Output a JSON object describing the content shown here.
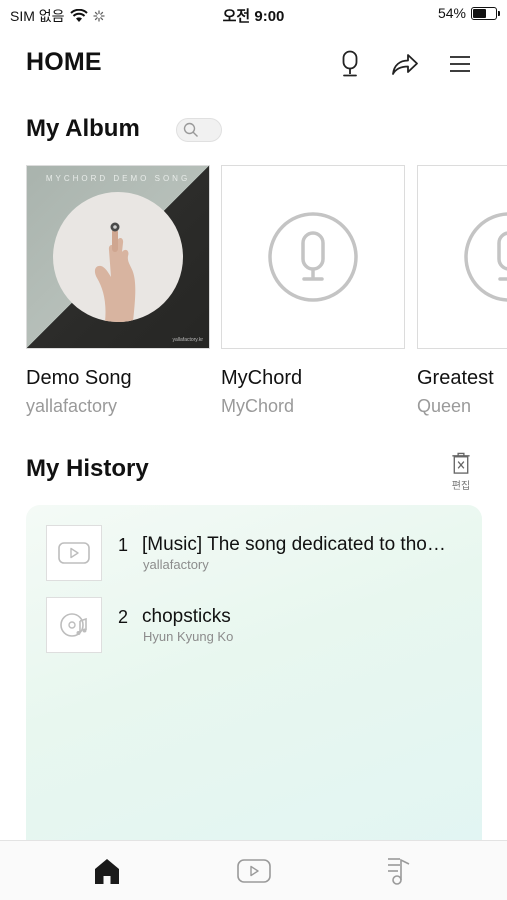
{
  "status_bar": {
    "carrier": "SIM 없음",
    "time": "오전 9:00",
    "battery": "54%",
    "battery_level": 0.54
  },
  "header": {
    "title": "HOME",
    "icons": [
      "microphone-icon",
      "share-icon",
      "menu-icon"
    ]
  },
  "album_section": {
    "title": "My Album",
    "toggle_icon": "search-icon",
    "cover_text": "MYCHORD DEMO SONG",
    "cover_footer": "yallafactory.kr",
    "albums": [
      {
        "name": "Demo Song",
        "artist": "yallafactory",
        "cover": "demo-art"
      },
      {
        "name": "MyChord",
        "artist": "MyChord",
        "cover": "microphone-placeholder"
      },
      {
        "name": "Greatest",
        "artist": "Queen",
        "cover": "microphone-placeholder"
      }
    ]
  },
  "history_section": {
    "title": "My History",
    "edit_label": "편집",
    "edit_icon": "trash-icon",
    "items": [
      {
        "number": "1",
        "title": "[Music] The song dedicated to tho…",
        "subtitle": "yallafactory",
        "icon": "video-play-icon"
      },
      {
        "number": "2",
        "title": "chopsticks",
        "subtitle": "Hyun Kyung Ko",
        "icon": "music-disc-icon"
      }
    ]
  },
  "bottom_nav": {
    "items": [
      "home-icon",
      "video-icon",
      "playlist-icon"
    ],
    "active": "home-icon"
  },
  "colors": {
    "text": "#111111",
    "secondary_text": "#9a9a9a",
    "history_bg": "#e6f6ef",
    "placeholder_icon": "#c4c4c4"
  }
}
